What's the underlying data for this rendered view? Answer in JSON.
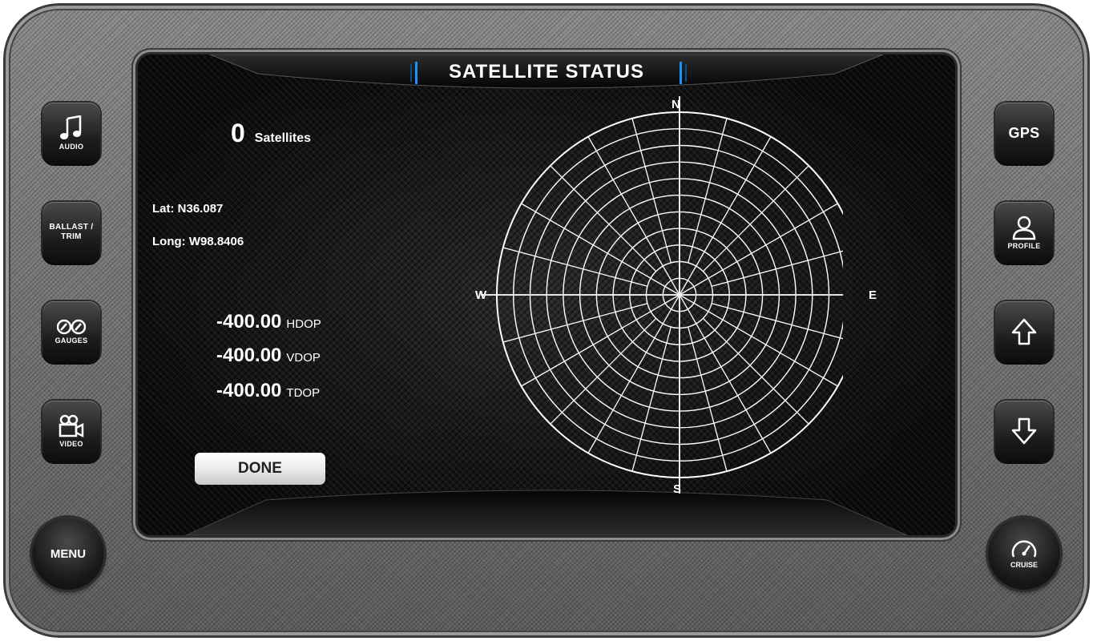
{
  "title": "SATELLITE STATUS",
  "satellites": {
    "count": "0",
    "label": "Satellites"
  },
  "position": {
    "lat": "Lat: N36.087",
    "long": "Long: W98.8406"
  },
  "dop": [
    {
      "value": "-400.00",
      "unit": "HDOP"
    },
    {
      "value": "-400.00",
      "unit": "VDOP"
    },
    {
      "value": "-400.00",
      "unit": "TDOP"
    }
  ],
  "done_label": "DONE",
  "compass": {
    "n": "N",
    "s": "S",
    "e": "E",
    "w": "W"
  },
  "left_buttons": {
    "audio": "AUDIO",
    "ballast": "BALLAST / TRIM",
    "gauges": "GAUGES",
    "video": "VIDEO",
    "menu": "MENU"
  },
  "right_buttons": {
    "gps": "GPS",
    "profile": "PROFILE",
    "cruise": "CRUISE"
  },
  "icons": {
    "audio": "music-note-icon",
    "gauges": "gauges-icon",
    "video": "video-camera-icon",
    "profile": "person-icon",
    "up": "arrow-up-icon",
    "down": "arrow-down-icon",
    "cruise": "speedometer-icon"
  },
  "colors": {
    "accent": "#1e90ff",
    "text": "#ffffff",
    "screen": "#101010"
  }
}
